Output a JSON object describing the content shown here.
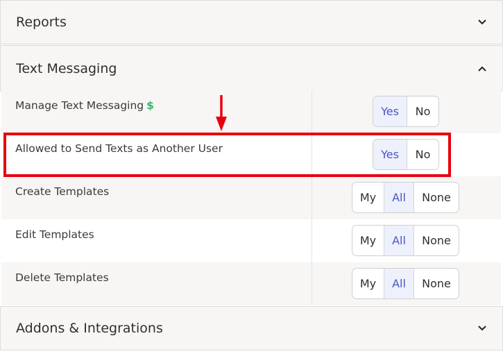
{
  "sections": {
    "reports": {
      "title": "Reports",
      "icon": "chevron-down-icon"
    },
    "text_messaging": {
      "title": "Text Messaging",
      "icon": "chevron-up-icon"
    },
    "addons": {
      "title": "Addons & Integrations",
      "icon": "chevron-down-icon"
    }
  },
  "rows": [
    {
      "label": "Manage Text Messaging",
      "suffix": "$",
      "options": [
        "Yes",
        "No"
      ],
      "selected": "Yes"
    },
    {
      "label": "Allowed to Send Texts as Another User",
      "options": [
        "Yes",
        "No"
      ],
      "selected": "Yes"
    },
    {
      "label": "Create Templates",
      "options": [
        "My",
        "All",
        "None"
      ],
      "selected": "All"
    },
    {
      "label": "Edit Templates",
      "options": [
        "My",
        "All",
        "None"
      ],
      "selected": "All"
    },
    {
      "label": "Delete Templates",
      "options": [
        "My",
        "All",
        "None"
      ],
      "selected": "All"
    }
  ],
  "colors": {
    "accent": "#4a56c8",
    "selected_bg": "#eef0fb",
    "highlight": "#e8000d",
    "dollar": "#3bb36b"
  }
}
